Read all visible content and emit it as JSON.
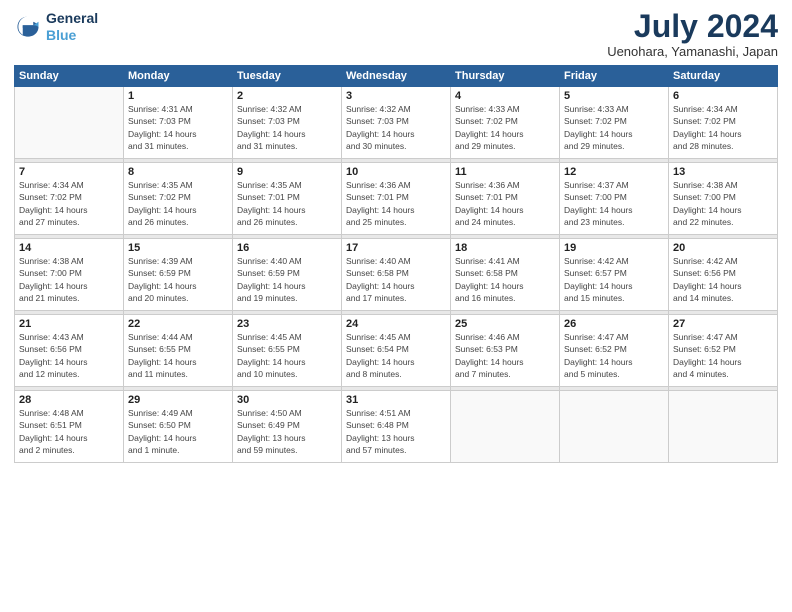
{
  "logo": {
    "line1": "General",
    "line2": "Blue"
  },
  "title": "July 2024",
  "subtitle": "Uenohara, Yamanashi, Japan",
  "days_of_week": [
    "Sunday",
    "Monday",
    "Tuesday",
    "Wednesday",
    "Thursday",
    "Friday",
    "Saturday"
  ],
  "weeks": [
    [
      {
        "day": "",
        "info": ""
      },
      {
        "day": "1",
        "info": "Sunrise: 4:31 AM\nSunset: 7:03 PM\nDaylight: 14 hours\nand 31 minutes."
      },
      {
        "day": "2",
        "info": "Sunrise: 4:32 AM\nSunset: 7:03 PM\nDaylight: 14 hours\nand 31 minutes."
      },
      {
        "day": "3",
        "info": "Sunrise: 4:32 AM\nSunset: 7:03 PM\nDaylight: 14 hours\nand 30 minutes."
      },
      {
        "day": "4",
        "info": "Sunrise: 4:33 AM\nSunset: 7:02 PM\nDaylight: 14 hours\nand 29 minutes."
      },
      {
        "day": "5",
        "info": "Sunrise: 4:33 AM\nSunset: 7:02 PM\nDaylight: 14 hours\nand 29 minutes."
      },
      {
        "day": "6",
        "info": "Sunrise: 4:34 AM\nSunset: 7:02 PM\nDaylight: 14 hours\nand 28 minutes."
      }
    ],
    [
      {
        "day": "7",
        "info": "Sunrise: 4:34 AM\nSunset: 7:02 PM\nDaylight: 14 hours\nand 27 minutes."
      },
      {
        "day": "8",
        "info": "Sunrise: 4:35 AM\nSunset: 7:02 PM\nDaylight: 14 hours\nand 26 minutes."
      },
      {
        "day": "9",
        "info": "Sunrise: 4:35 AM\nSunset: 7:01 PM\nDaylight: 14 hours\nand 26 minutes."
      },
      {
        "day": "10",
        "info": "Sunrise: 4:36 AM\nSunset: 7:01 PM\nDaylight: 14 hours\nand 25 minutes."
      },
      {
        "day": "11",
        "info": "Sunrise: 4:36 AM\nSunset: 7:01 PM\nDaylight: 14 hours\nand 24 minutes."
      },
      {
        "day": "12",
        "info": "Sunrise: 4:37 AM\nSunset: 7:00 PM\nDaylight: 14 hours\nand 23 minutes."
      },
      {
        "day": "13",
        "info": "Sunrise: 4:38 AM\nSunset: 7:00 PM\nDaylight: 14 hours\nand 22 minutes."
      }
    ],
    [
      {
        "day": "14",
        "info": "Sunrise: 4:38 AM\nSunset: 7:00 PM\nDaylight: 14 hours\nand 21 minutes."
      },
      {
        "day": "15",
        "info": "Sunrise: 4:39 AM\nSunset: 6:59 PM\nDaylight: 14 hours\nand 20 minutes."
      },
      {
        "day": "16",
        "info": "Sunrise: 4:40 AM\nSunset: 6:59 PM\nDaylight: 14 hours\nand 19 minutes."
      },
      {
        "day": "17",
        "info": "Sunrise: 4:40 AM\nSunset: 6:58 PM\nDaylight: 14 hours\nand 17 minutes."
      },
      {
        "day": "18",
        "info": "Sunrise: 4:41 AM\nSunset: 6:58 PM\nDaylight: 14 hours\nand 16 minutes."
      },
      {
        "day": "19",
        "info": "Sunrise: 4:42 AM\nSunset: 6:57 PM\nDaylight: 14 hours\nand 15 minutes."
      },
      {
        "day": "20",
        "info": "Sunrise: 4:42 AM\nSunset: 6:56 PM\nDaylight: 14 hours\nand 14 minutes."
      }
    ],
    [
      {
        "day": "21",
        "info": "Sunrise: 4:43 AM\nSunset: 6:56 PM\nDaylight: 14 hours\nand 12 minutes."
      },
      {
        "day": "22",
        "info": "Sunrise: 4:44 AM\nSunset: 6:55 PM\nDaylight: 14 hours\nand 11 minutes."
      },
      {
        "day": "23",
        "info": "Sunrise: 4:45 AM\nSunset: 6:55 PM\nDaylight: 14 hours\nand 10 minutes."
      },
      {
        "day": "24",
        "info": "Sunrise: 4:45 AM\nSunset: 6:54 PM\nDaylight: 14 hours\nand 8 minutes."
      },
      {
        "day": "25",
        "info": "Sunrise: 4:46 AM\nSunset: 6:53 PM\nDaylight: 14 hours\nand 7 minutes."
      },
      {
        "day": "26",
        "info": "Sunrise: 4:47 AM\nSunset: 6:52 PM\nDaylight: 14 hours\nand 5 minutes."
      },
      {
        "day": "27",
        "info": "Sunrise: 4:47 AM\nSunset: 6:52 PM\nDaylight: 14 hours\nand 4 minutes."
      }
    ],
    [
      {
        "day": "28",
        "info": "Sunrise: 4:48 AM\nSunset: 6:51 PM\nDaylight: 14 hours\nand 2 minutes."
      },
      {
        "day": "29",
        "info": "Sunrise: 4:49 AM\nSunset: 6:50 PM\nDaylight: 14 hours\nand 1 minute."
      },
      {
        "day": "30",
        "info": "Sunrise: 4:50 AM\nSunset: 6:49 PM\nDaylight: 13 hours\nand 59 minutes."
      },
      {
        "day": "31",
        "info": "Sunrise: 4:51 AM\nSunset: 6:48 PM\nDaylight: 13 hours\nand 57 minutes."
      },
      {
        "day": "",
        "info": ""
      },
      {
        "day": "",
        "info": ""
      },
      {
        "day": "",
        "info": ""
      }
    ]
  ]
}
